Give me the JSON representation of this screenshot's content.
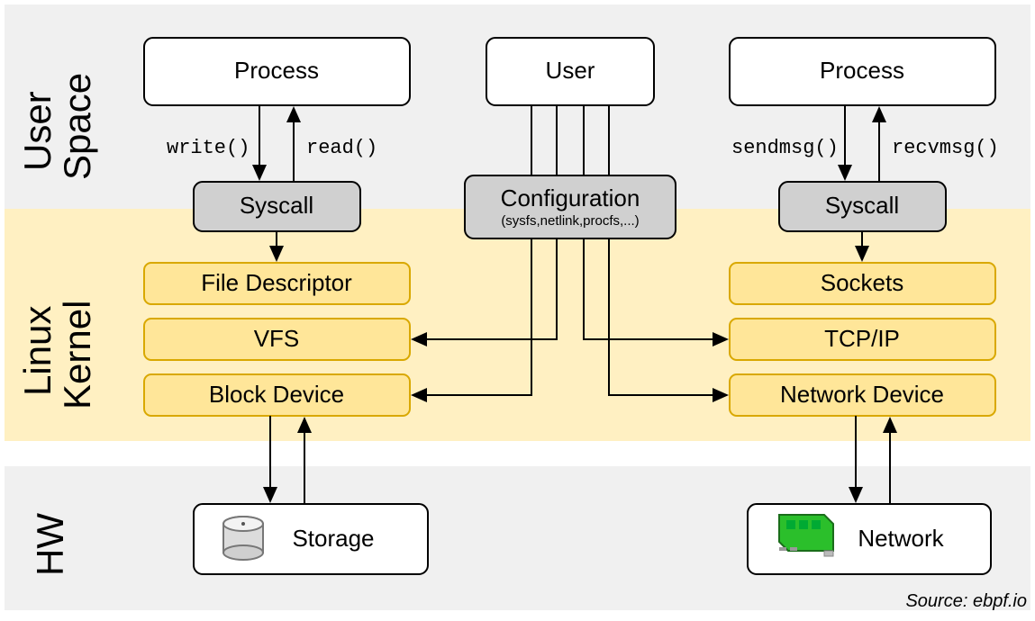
{
  "bands": {
    "user_space": "User\nSpace",
    "linux_kernel": "Linux\nKernel",
    "hw": "HW"
  },
  "nodes": {
    "process_left": "Process",
    "user_center": "User",
    "process_right": "Process",
    "syscall_left": "Syscall",
    "configuration": "Configuration",
    "configuration_sub": "(sysfs,netlink,procfs,...)",
    "syscall_right": "Syscall",
    "file_descriptor": "File Descriptor",
    "vfs": "VFS",
    "block_device": "Block Device",
    "sockets": "Sockets",
    "tcpip": "TCP/IP",
    "network_device": "Network Device",
    "storage": "Storage",
    "network": "Network"
  },
  "calls": {
    "write": "write()",
    "read": "read()",
    "sendmsg": "sendmsg()",
    "recvmsg": "recvmsg()"
  },
  "source": "Source: ebpf.io"
}
